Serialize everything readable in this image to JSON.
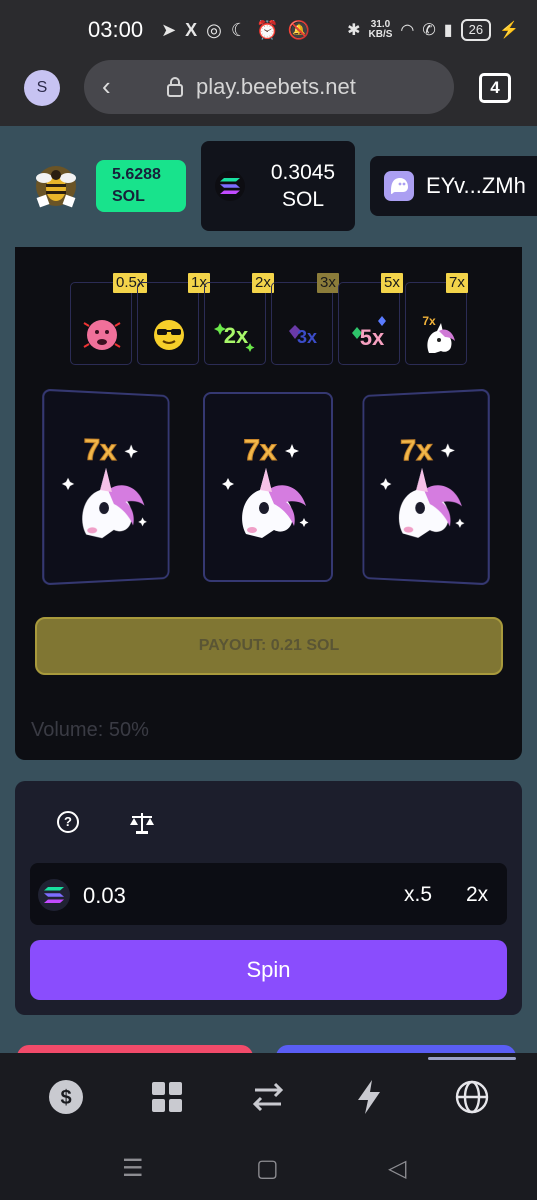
{
  "status_bar": {
    "time": "03:00",
    "speed_value": "31.0",
    "speed_unit": "KB/S",
    "battery": "26"
  },
  "browser": {
    "avatar_letter": "S",
    "url": "play.beebets.net",
    "tab_count": "4"
  },
  "header": {
    "balance_value": "5.6288",
    "balance_unit": "SOL",
    "wallet_value": "0.3045",
    "wallet_unit": "SOL",
    "account": "EYv...ZMh"
  },
  "multipliers": [
    {
      "label": "0.5x",
      "icon": "angry-face-icon"
    },
    {
      "label": "1x",
      "icon": "sunglasses-face-icon"
    },
    {
      "label": "2x",
      "icon": "2x-sparkle-icon"
    },
    {
      "label": "3x",
      "icon": "3x-gem-icon"
    },
    {
      "label": "5x",
      "icon": "5x-gem-icon"
    },
    {
      "label": "7x",
      "icon": "7x-unicorn-icon"
    }
  ],
  "reels": [
    "7x-unicorn-icon",
    "7x-unicorn-icon",
    "7x-unicorn-icon"
  ],
  "game": {
    "payout": "PAYOUT: 0.21 SOL",
    "volume": "Volume: 50%"
  },
  "controls": {
    "help": "?",
    "bet_amount": "0.03",
    "half_label": "x.5",
    "double_label": "2x",
    "spin_label": "Spin"
  },
  "colors": {
    "accent": "#8a4dfd",
    "balance_green": "#18e38c",
    "multiplier_tag": "#f3d44a",
    "payout": "#807633"
  }
}
